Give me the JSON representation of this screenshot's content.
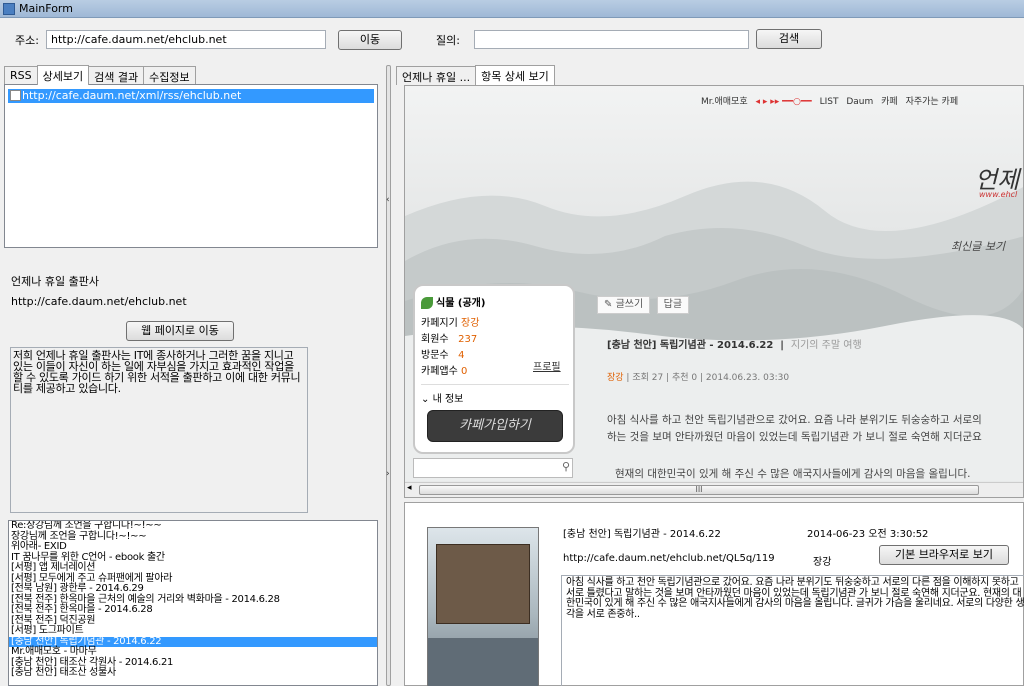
{
  "window": {
    "title": "MainForm"
  },
  "toolbar": {
    "address_label": "주소:",
    "address_value": "http://cafe.daum.net/ehclub.net",
    "go_label": "이동",
    "query_label": "질의:",
    "query_value": "",
    "search_label": "검색"
  },
  "left_tabs": [
    "RSS",
    "상세보기",
    "검색 결과",
    "수집정보"
  ],
  "rss_items": [
    {
      "label": "http://cafe.daum.net/xml/rss/ehclub.net"
    }
  ],
  "info": {
    "name": "언제나 휴일 출판사",
    "url": "http://cafe.daum.net/ehclub.net",
    "webpage_button": "웹 페이지로 이동",
    "description": "저희 언제나 휴일 출판사는 IT에 종사하거나 그러한 꿈을 지니고 있는 이들이 자신이 하는 일에 자부심을 가지고 효과적인 작업을 할 수 있도록 가이드 하기 위한 서적을 출판하고 이에 대한 커뮤니티를 제공하고 있습니다."
  },
  "articles": [
    "Re:장강님께 조언을 구합니다!~!~~",
    "장강님께 조언을 구합니다!~!~~",
    "위아래- EXID",
    "IT 꿈나무를 위한 C언어 - ebook 출간",
    "[서평] 앱 제너레이션",
    "[서평] 모두에게 주고 슈퍼팬에게 팔아라",
    "[전북 남원] 광한루 - 2014.6.29",
    "[전북 전주] 한옥마을 근처의 예술의 거리와 벽화마을 - 2014.6.28",
    "[전북 전주] 한옥마을 - 2014.6.28",
    "[전북 전주] 덕진공원",
    "[서평] 도그파이트",
    "[충남 천안] 독립기념관 - 2014.6.22",
    "Mr.애매모호 - 마마무",
    "[충남 천안] 태조산 각원사 - 2014.6.21",
    "[충남 천안] 태조산 성불사"
  ],
  "selected_article_index": 11,
  "right_tabs": [
    "언제나 휴일 ...",
    "항목 상세 보기"
  ],
  "browser": {
    "topnav": [
      "Mr.애매모호",
      "LIST",
      "Daum",
      "카페",
      "자주가는 카페"
    ],
    "brand": "언제",
    "brand_url": "www.ehcl",
    "latest_link": "최신글 보기",
    "cafe_title": "식물 (공개)",
    "cafe_rows": [
      {
        "label": "카페지기",
        "value": "장강"
      },
      {
        "label": "회원수",
        "value": "237"
      },
      {
        "label": "방문수",
        "value": "4"
      },
      {
        "label": "카페앱수",
        "value": "0"
      }
    ],
    "profile_link": "프로필",
    "my_info": "내 정보",
    "join_button": "카페가입하기",
    "write_button": "글쓰기",
    "reply_button": "답글",
    "post_title": "[충남 천안] 독립기념관 - 2014.6.22",
    "post_category": "지기의 주말 여행",
    "post_author": "장강",
    "post_views": "조회 27",
    "post_recommend": "추천 0",
    "post_date": "2014.06.23. 03:30",
    "post_body_1": "아침 식사를 하고 천안 독립기념관으로 갔어요. 요즘 나라 분위기도 뒤숭숭하고 서로의",
    "post_body_2": "하는 것을 보며 안타까웠던 마음이 있었는데 독립기념관 가 보니 절로 숙연해 지더군요",
    "post_body_3": "현재의 대한민국이 있게 해 주신 수 많은 애국지사들에게 감사의 마음을 올립니다.",
    "scroll_label": "III"
  },
  "detail": {
    "title": "[충남 천안] 독립기념관 - 2014.6.22",
    "date": "2014-06-23 오전 3:30:52",
    "url": "http://cafe.daum.net/ehclub.net/QL5q/119",
    "author": "장강",
    "open_button": "기본 브라우저로 보기",
    "body": "아침 식사를 하고 천안 독립기념관으로 갔어요. 요즘 나라 분위기도 뒤숭숭하고 서로의 다른 점을 이해하지 못하고 서로 틀렸다고 말하는 것을 보며 안타까웠던 마음이 있었는데 독립기념관 가 보니 절로 숙연해 지더군요. 현재의 대한민국이 있게 해 주신 수 많은 애국지사들에게 감사의 마음을 올립니다. 글귀가 가슴을 울리네요. 서로의 다양한 생각을 서로 존중하.."
  }
}
